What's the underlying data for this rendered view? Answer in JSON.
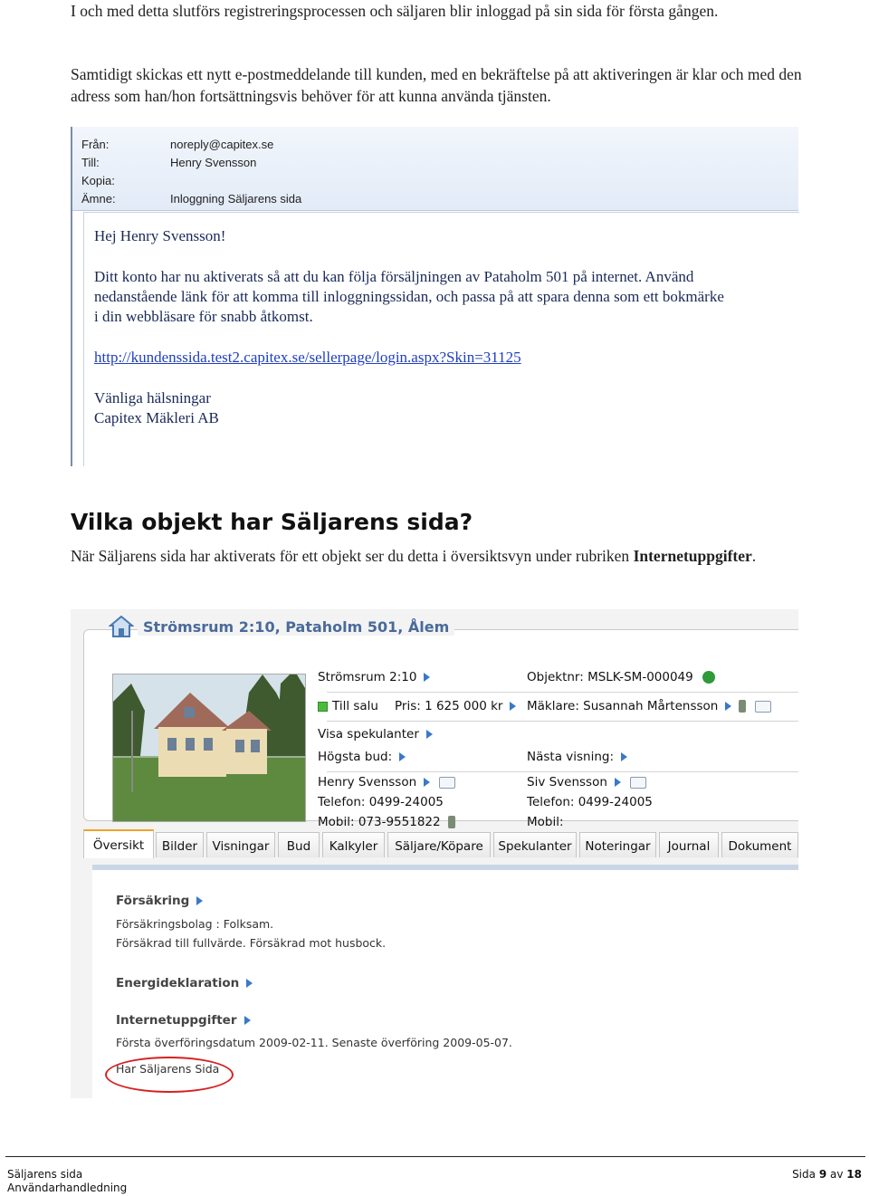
{
  "intro": {
    "para1": "I och med detta slutförs registreringsprocessen och säljaren blir inloggad på sin sida för första gången.",
    "para2": "Samtidigt skickas ett nytt e-postmeddelande till kunden, med en bekräftelse på att aktiveringen är klar och med den adress som han/hon fortsättningsvis behöver för att kunna använda tjänsten."
  },
  "email": {
    "headers": [
      {
        "key": "Från:",
        "value": "noreply@capitex.se"
      },
      {
        "key": "Till:",
        "value": "Henry Svensson"
      },
      {
        "key": "Kopia:",
        "value": ""
      },
      {
        "key": "Ämne:",
        "value": "Inloggning Säljarens sida"
      }
    ],
    "greeting": "Hej Henry Svensson!",
    "body_lines": [
      "Ditt konto har nu aktiverats så att du kan följa försäljningen av Pataholm 501 på internet. Använd",
      "nedanstående länk för att komma till inloggningssidan, och passa på att spara denna som ett bokmärke",
      "i din webbläsare för snabb åtkomst."
    ],
    "link": "http://kundenssida.test2.capitex.se/sellerpage/login.aspx?Skin=31125",
    "closing": "Vänliga hälsningar",
    "signature": "Capitex Mäkleri AB"
  },
  "section": {
    "heading": "Vilka objekt har Säljarens sida?",
    "text_before": "När Säljarens sida har aktiverats för ett objekt ser du detta i översiktsvyn under rubriken ",
    "text_bold": "Internetuppgifter",
    "text_after": "."
  },
  "property": {
    "title": "Strömsrum 2:10, Pataholm 501, Ålem",
    "name": "Strömsrum 2:10",
    "objektnr": "Objektnr: MSLK-SM-000049",
    "status": "Till salu",
    "price": "Pris: 1 625 000 kr",
    "maklare": "Mäklare: Susannah Mårtensson",
    "visa_spekulanter": "Visa spekulanter",
    "hogsta_bud": "Högsta bud:",
    "nasta_visning": "Nästa visning:",
    "seller1": {
      "name": "Henry Svensson",
      "phone": "Telefon: 0499-24005",
      "mobile": "Mobil: 073-9551822"
    },
    "seller2": {
      "name": "Siv Svensson",
      "phone": "Telefon: 0499-24005",
      "mobile": "Mobil:"
    },
    "tabs": [
      "Översikt",
      "Bilder",
      "Visningar",
      "Bud",
      "Kalkyler",
      "Säljare/Köpare",
      "Spekulanter",
      "Noteringar",
      "Journal",
      "Dokument"
    ],
    "forsakring": {
      "heading": "Försäkring",
      "line1": "Försäkringsbolag : Folksam.",
      "line2": "Försäkrad till fullvärde. Försäkrad mot husbock."
    },
    "energi": {
      "heading": "Energideklaration"
    },
    "internet": {
      "heading": "Internetuppgifter",
      "line1": "Första överföringsdatum 2009-02-11. Senaste överföring 2009-05-07.",
      "line2": "Har Säljarens Sida"
    },
    "colors": {
      "accent": "#4a6a9a",
      "arrow": "#3a78c8",
      "highlight": "#d62020",
      "status_green": "#4cbb3c"
    }
  },
  "footer": {
    "line1": "Säljarens sida",
    "line2": "Användarhandledning",
    "page_label": "Sida",
    "page_num": "9",
    "of_label": "av",
    "page_total": "18"
  }
}
